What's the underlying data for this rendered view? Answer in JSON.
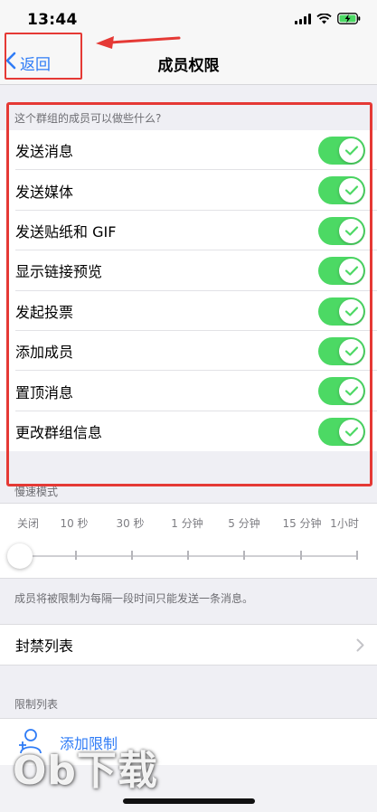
{
  "status_bar": {
    "time": "13:44"
  },
  "nav": {
    "back_label": "返回",
    "title": "成员权限"
  },
  "permissions": {
    "header": "这个群组的成员可以做些什么?",
    "items": [
      {
        "label": "发送消息",
        "enabled": true
      },
      {
        "label": "发送媒体",
        "enabled": true
      },
      {
        "label": "发送贴纸和 GIF",
        "enabled": true
      },
      {
        "label": "显示链接预览",
        "enabled": true
      },
      {
        "label": "发起投票",
        "enabled": true
      },
      {
        "label": "添加成员",
        "enabled": true
      },
      {
        "label": "置顶消息",
        "enabled": true
      },
      {
        "label": "更改群组信息",
        "enabled": true
      }
    ]
  },
  "slow_mode": {
    "header": "慢速模式",
    "options": [
      "关闭",
      "10 秒",
      "30 秒",
      "1 分钟",
      "5 分钟",
      "15 分钟",
      "1小时"
    ],
    "selected": "关闭",
    "note": "成员将被限制为每隔一段时间只能发送一条消息。"
  },
  "ban_list": {
    "label": "封禁列表"
  },
  "restrictions": {
    "header": "限制列表",
    "add_label": "添加限制"
  },
  "watermark": "Ob下载",
  "colors": {
    "accent": "#2f7cf6",
    "toggle_on": "#4cd964",
    "annotation": "#e53935"
  }
}
